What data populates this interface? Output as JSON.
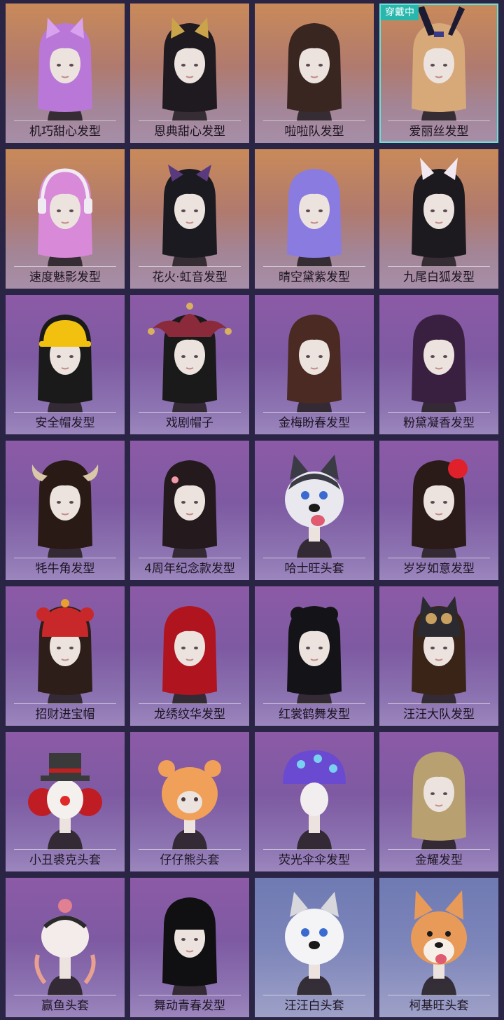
{
  "badge_label": "穿戴中",
  "colors": {
    "equipped_border": "#6ee0d6",
    "badge_bg": "#29b7ad",
    "label_text": "#1c1420"
  },
  "items": [
    {
      "label": "机巧甜心发型",
      "bg": "warm",
      "hair": "#b978d8",
      "acc": "cat-ears",
      "accColor": "#d8a2ee",
      "equipped": false
    },
    {
      "label": "恩典甜心发型",
      "bg": "warm",
      "hair": "#1e1a1f",
      "acc": "cat-ears",
      "accColor": "#c9a44a",
      "equipped": false
    },
    {
      "label": "啦啦队发型",
      "bg": "warm",
      "hair": "#3a2620",
      "acc": "none",
      "accColor": "",
      "equipped": false
    },
    {
      "label": "爱丽丝发型",
      "bg": "warm",
      "hair": "#d7a878",
      "acc": "bunny-ears",
      "accColor": "#1b1a33",
      "equipped": true
    },
    {
      "label": "速度魅影发型",
      "bg": "warm",
      "hair": "#d889d8",
      "acc": "headphones",
      "accColor": "#f0eaf2",
      "equipped": false
    },
    {
      "label": "花火·虹音发型",
      "bg": "warm",
      "hair": "#1b1a20",
      "acc": "bow-ears",
      "accColor": "#5a3a7e",
      "equipped": false
    },
    {
      "label": "晴空黛紫发型",
      "bg": "warm",
      "hair": "#8a7be0",
      "acc": "none",
      "accColor": "",
      "equipped": false
    },
    {
      "label": "九尾白狐发型",
      "bg": "warm",
      "hair": "#1d1a1f",
      "acc": "fox-ears",
      "accColor": "#f2e9f0",
      "equipped": false
    },
    {
      "label": "安全帽发型",
      "bg": "purple",
      "hair": "#1a1a1a",
      "acc": "hardhat",
      "accColor": "#f2c10f",
      "equipped": false
    },
    {
      "label": "戏剧帽子",
      "bg": "purple",
      "hair": "#1a1a1a",
      "acc": "jester",
      "accColor": "#8a2a3a",
      "equipped": false
    },
    {
      "label": "金梅盼春发型",
      "bg": "purple",
      "hair": "#4a2a22",
      "acc": "none",
      "accColor": "",
      "equipped": false
    },
    {
      "label": "粉黛凝香发型",
      "bg": "purple",
      "hair": "#3a2040",
      "acc": "none",
      "accColor": "",
      "equipped": false
    },
    {
      "label": "牦牛角发型",
      "bg": "purple",
      "hair": "#2a1a16",
      "acc": "horns",
      "accColor": "#d8c8a8",
      "equipped": false
    },
    {
      "label": "4周年纪念款发型",
      "bg": "purple",
      "hair": "#241a1e",
      "acc": "clip",
      "accColor": "#f29aa8",
      "equipped": false
    },
    {
      "label": "哈士旺头套",
      "bg": "purple",
      "hair": "#2e2f38",
      "acc": "husky",
      "accColor": "#f2f2f6",
      "equipped": false
    },
    {
      "label": "岁岁如意发型",
      "bg": "purple",
      "hair": "#2a1a18",
      "acc": "flower",
      "accColor": "#e0202a",
      "equipped": false
    },
    {
      "label": "招财进宝帽",
      "bg": "purple",
      "hair": "#2e1e1a",
      "acc": "beanie",
      "accColor": "#c8282a",
      "equipped": false
    },
    {
      "label": "龙绣纹华发型",
      "bg": "purple",
      "hair": "#b0141e",
      "acc": "none",
      "accColor": "",
      "equipped": false
    },
    {
      "label": "红裳鹤舞发型",
      "bg": "purple",
      "hair": "#141418",
      "acc": "buns",
      "accColor": "#141418",
      "equipped": false
    },
    {
      "label": "汪汪大队发型",
      "bg": "purple",
      "hair": "#3a2418",
      "acc": "dog-cap",
      "accColor": "#2a2a30",
      "equipped": false
    },
    {
      "label": "小丑裘克头套",
      "bg": "purple",
      "hair": "#c01c24",
      "acc": "clown",
      "accColor": "#3a3a3a",
      "equipped": false
    },
    {
      "label": "仔仔熊头套",
      "bg": "purple",
      "hair": "#e89850",
      "acc": "bear",
      "accColor": "#f0a058",
      "equipped": false
    },
    {
      "label": "荧光伞伞发型",
      "bg": "purple",
      "hair": "#2e3a9a",
      "acc": "mushroom",
      "accColor": "#6a4ad0",
      "equipped": false
    },
    {
      "label": "金耀发型",
      "bg": "purple",
      "hair": "#b8a070",
      "acc": "none",
      "accColor": "",
      "equipped": false
    },
    {
      "label": "赢鱼头套",
      "bg": "purple",
      "hair": "#e8a090",
      "acc": "lion",
      "accColor": "#2a2a2a",
      "equipped": false
    },
    {
      "label": "舞动青春发型",
      "bg": "purple",
      "hair": "#101012",
      "acc": "bangs",
      "accColor": "#101012",
      "equipped": false
    },
    {
      "label": "汪汪白头套",
      "bg": "blue",
      "hair": "#f2f2f4",
      "acc": "white-dog",
      "accColor": "#f2f2f4",
      "equipped": false
    },
    {
      "label": "柯基旺头套",
      "bg": "blue",
      "hair": "#e8a060",
      "acc": "corgi",
      "accColor": "#e89a58",
      "equipped": false
    }
  ]
}
